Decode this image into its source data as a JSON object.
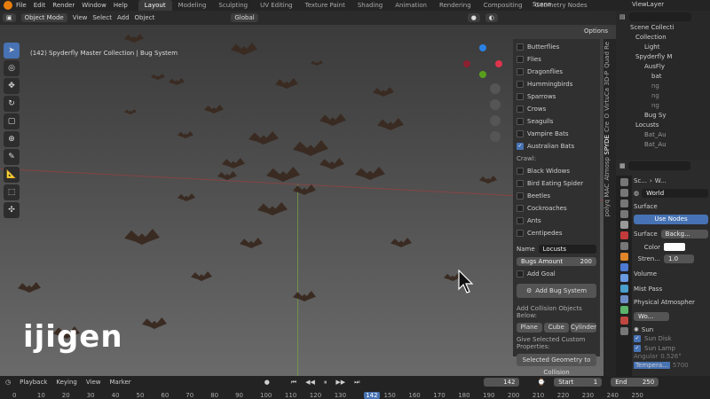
{
  "topbar": {
    "menus": [
      "File",
      "Edit",
      "Render",
      "Window",
      "Help"
    ],
    "workspaces": [
      "Layout",
      "Modeling",
      "Sculpting",
      "UV Editing",
      "Texture Paint",
      "Shading",
      "Animation",
      "Rendering",
      "Compositing",
      "Geometry Nodes"
    ],
    "scene": "Scene",
    "view_layer": "ViewLayer"
  },
  "viewport_header": {
    "mode": "Object Mode",
    "menus": [
      "View",
      "Select",
      "Add",
      "Object"
    ],
    "orientation": "Global",
    "options": "Options"
  },
  "viewport": {
    "frame_label": "(142) Spyderfly Master Collection | Bug System",
    "watermark": "ijigen"
  },
  "npanel": {
    "checkboxes": [
      {
        "label": "Butterflies",
        "checked": false
      },
      {
        "label": "Flies",
        "checked": false
      },
      {
        "label": "Dragonflies",
        "checked": false
      },
      {
        "label": "Hummingbirds",
        "checked": false
      },
      {
        "label": "Sparrows",
        "checked": false
      },
      {
        "label": "Crows",
        "checked": false
      },
      {
        "label": "Seagulls",
        "checked": false
      },
      {
        "label": "Vampire Bats",
        "checked": false
      },
      {
        "label": "Australian Bats",
        "checked": true
      }
    ],
    "crawl_label": "Crawl:",
    "crawl": [
      {
        "label": "Black Widows",
        "checked": false
      },
      {
        "label": "Bird Eating Spider",
        "checked": false
      },
      {
        "label": "Beetles",
        "checked": false
      },
      {
        "label": "Cockroaches",
        "checked": false
      },
      {
        "label": "Ants",
        "checked": false
      },
      {
        "label": "Centipedes",
        "checked": false
      }
    ],
    "name_label": "Name",
    "name_value": "Locusts",
    "bugs_amount_label": "Bugs Amount",
    "bugs_amount_value": "200",
    "add_goal": "Add Goal",
    "add_bug_system": "Add Bug System",
    "collision_label": "Add Collision Objects Below:",
    "collision_buttons": [
      "Plane",
      "Cube",
      "Cylinder"
    ],
    "give_selected": "Give Selected Custom Properties:",
    "selected_geometry": "Selected Geometry to Collision"
  },
  "sidetabs": [
    "Quad Re",
    "3D-P",
    "VirtuCa",
    "O",
    "Cre",
    "SPYDE",
    "Atmosp",
    "MAC",
    "polyq"
  ],
  "outliner": {
    "items": [
      "Scene Collecti",
      "Collection",
      "Light",
      "Spyderfly M",
      "AusFly",
      "bat",
      "ng",
      "ng",
      "ng",
      "Bug Sy",
      "Locusts",
      "Bat_Au",
      "Bat_Au"
    ]
  },
  "properties": {
    "breadcrumb_a": "Sc...",
    "breadcrumb_b": "W...",
    "world_name": "World",
    "surface_title": "Surface",
    "use_nodes": "Use Nodes",
    "surface_label": "Surface",
    "surface_value": "Backg...",
    "color_label": "Color",
    "strength_label": "Stren...",
    "strength_value": "1.0",
    "volume": "Volume",
    "mist": "Mist Pass",
    "atmosphere": "Physical Atmospher",
    "wo_field": "Wo...",
    "sun": "Sun",
    "sun_disk": "Sun Disk",
    "sun_lamp": "Sun Lamp",
    "angular": "Angular",
    "angular_value": "0.526°",
    "temperature": "Tempera...",
    "temperature_value": "5700"
  },
  "timeline": {
    "menus": [
      "Playback",
      "Keying",
      "View",
      "Marker"
    ],
    "current_frame": "142",
    "start_label": "Start",
    "start_value": "1",
    "end_label": "End",
    "end_value": "250",
    "ruler": [
      "0",
      "10",
      "20",
      "30",
      "40",
      "50",
      "60",
      "70",
      "80",
      "90",
      "100",
      "110",
      "120",
      "130",
      "142",
      "150",
      "160",
      "170",
      "180",
      "190",
      "200",
      "210",
      "220",
      "230",
      "240",
      "250"
    ]
  },
  "colors": {
    "accent": "#4772b3",
    "frame_marker": "#4772b3",
    "brand": "#e87d0d"
  }
}
